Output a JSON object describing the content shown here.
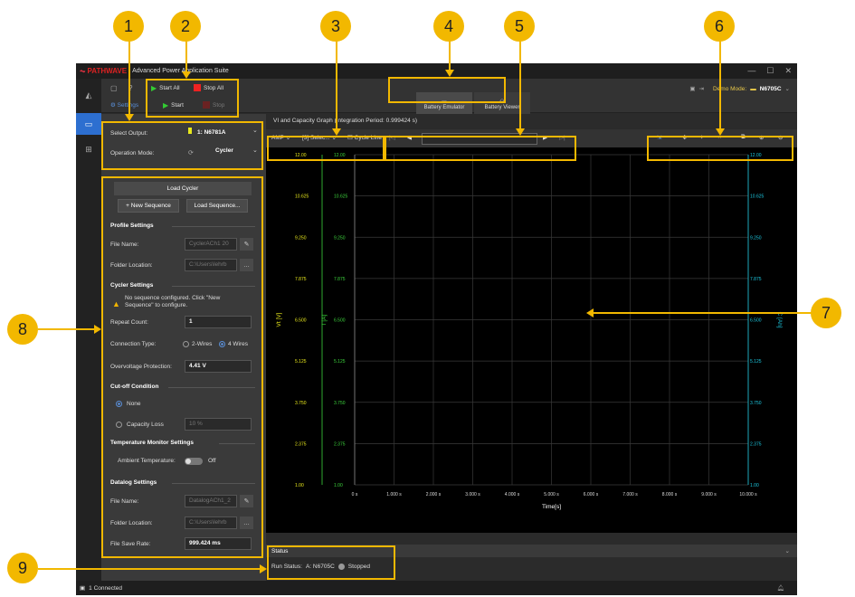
{
  "app": {
    "logo": "PATHWAVE",
    "title": "Advanced Power Application Suite"
  },
  "toolbar": {
    "start_all": "Start All",
    "stop_all": "Stop All",
    "start": "Start",
    "stop": "Stop",
    "settings": "Settings"
  },
  "tabs": [
    {
      "label": "Battery Emulator"
    },
    {
      "label": "Battery Viewer"
    }
  ],
  "demo": {
    "label": "Demo Mode:",
    "instrument": "N6705C"
  },
  "output": {
    "label": "Select Output:",
    "value": "1: N6781A",
    "mode_label": "Operation Mode:",
    "mode_value": "Cycler"
  },
  "cycler": {
    "load_title": "Load Cycler",
    "new_sequence": "+ New Sequence",
    "load_sequence": "Load Sequence...",
    "profile_settings": "Profile Settings",
    "file_name_label": "File Name:",
    "file_name_value": "CyclerACh1 20",
    "folder_label": "Folder Location:",
    "folder_value": "C:\\Users\\lehrb",
    "cycler_settings": "Cycler Settings",
    "warning": "No sequence configured. Click \"New Sequence\" to configure.",
    "repeat_label": "Repeat Count:",
    "repeat_value": "1",
    "connection_label": "Connection Type:",
    "two_wires": "2-Wires",
    "four_wires": "4 Wires",
    "ovp_label": "Overvoltage Protection:",
    "ovp_value": "4.41 V",
    "cutoff": "Cut-off Condition",
    "none": "None",
    "capacity_loss": "Capacity Loss",
    "capacity_value": "10 %",
    "temp_settings": "Temperature Monitor Settings",
    "ambient_label": "Ambient Temperature:",
    "ambient_value": "Off",
    "datalog_settings": "Datalog Settings",
    "dl_file_label": "File Name:",
    "dl_file_value": "DatalogACh1_2",
    "dl_folder_label": "Folder Location:",
    "dl_folder_value": "C:\\Users\\lehrb",
    "save_rate_label": "File Save Rate:",
    "save_rate_value": "999.424 ms"
  },
  "graph": {
    "title": "VI and Capacity Graph (Integration Period: 0.999424 s)",
    "amp": "AMP",
    "select": "[3] Selec...",
    "cycle_line": "Cycle Line"
  },
  "chart_data": {
    "type": "line",
    "xlabel": "Time[s]",
    "y1label": "Vt [V]",
    "y2label": "I [A]",
    "y3label": "C [Ah]",
    "xlim": [
      0,
      10
    ],
    "ylim": [
      1.0,
      12.0
    ],
    "x_ticks": [
      "0 s",
      "1.000 s",
      "2.000 s",
      "3.000 s",
      "4.000 s",
      "5.000 s",
      "6.000 s",
      "7.000 s",
      "8.000 s",
      "9.000 s",
      "10.000 s"
    ],
    "y_ticks": [
      "12.00",
      "10.625",
      "9.250",
      "7.875",
      "6.500",
      "5.125",
      "3.750",
      "2.375",
      "1.00"
    ],
    "series": [],
    "grid": true,
    "colors": {
      "vt": "#e8e81c",
      "i": "#3cd23c",
      "c": "#1cc8e0"
    }
  },
  "status": {
    "title": "Status",
    "run_label": "Run Status:",
    "run_value": "A: N6705C",
    "state": "Stopped"
  },
  "footer": {
    "connected": "1 Connected"
  },
  "callouts": [
    "1",
    "2",
    "3",
    "4",
    "5",
    "6",
    "7",
    "8",
    "9"
  ]
}
